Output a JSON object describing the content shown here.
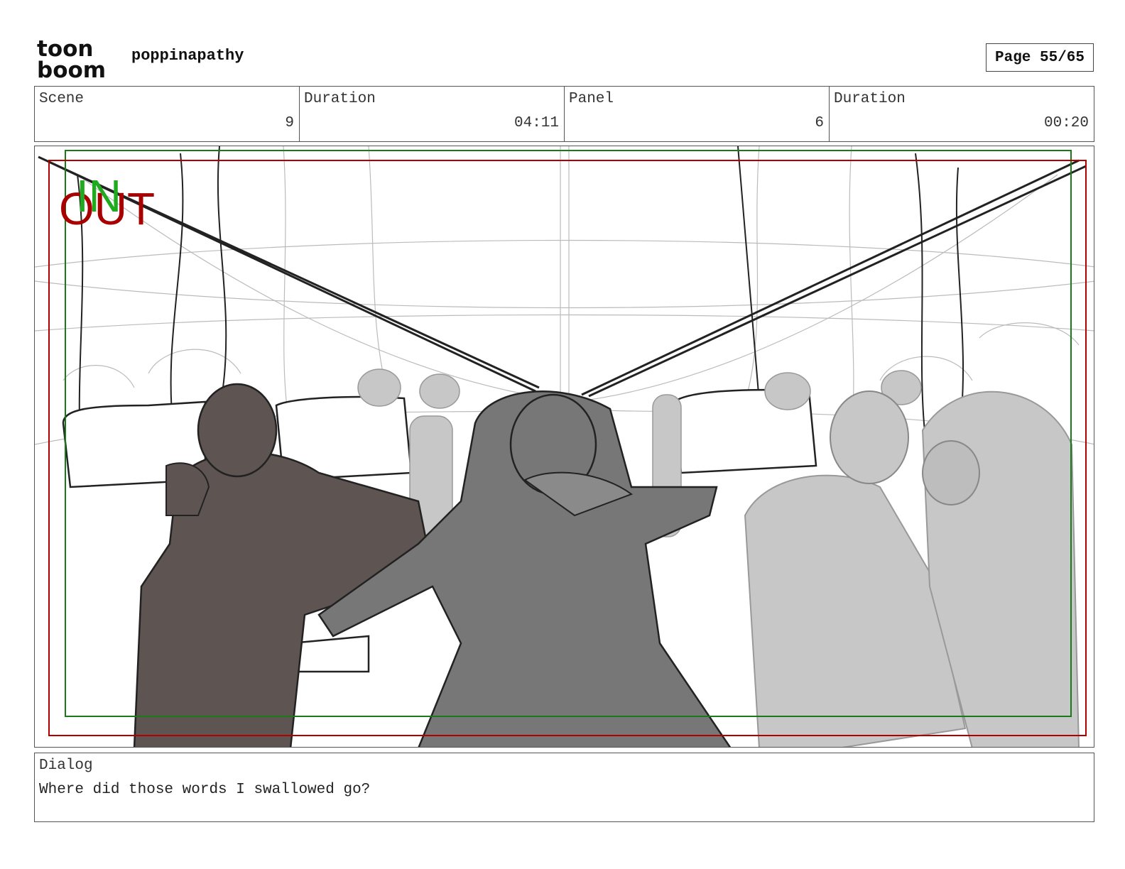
{
  "header": {
    "logo_text_top": "toon",
    "logo_text_bottom": "boom",
    "project_name": "poppinapathy",
    "page": "Page 55/65"
  },
  "info": {
    "scene_label": "Scene",
    "scene_value": "9",
    "scene_duration_label": "Duration",
    "scene_duration_value": "04:11",
    "panel_label": "Panel",
    "panel_value": "6",
    "panel_duration_label": "Duration",
    "panel_duration_value": "00:20"
  },
  "panel": {
    "in_marker": "IN",
    "out_marker": "OUT",
    "colors": {
      "in_frame": "#1a7a1a",
      "out_frame": "#b00000",
      "in_text": "#1faa1f",
      "out_text": "#a80000",
      "character_dark": "#5e5452",
      "character_mid": "#777777",
      "character_light": "#c7c7c7"
    }
  },
  "dialog": {
    "label": "Dialog",
    "text": "Where did those words I swallowed go?"
  }
}
